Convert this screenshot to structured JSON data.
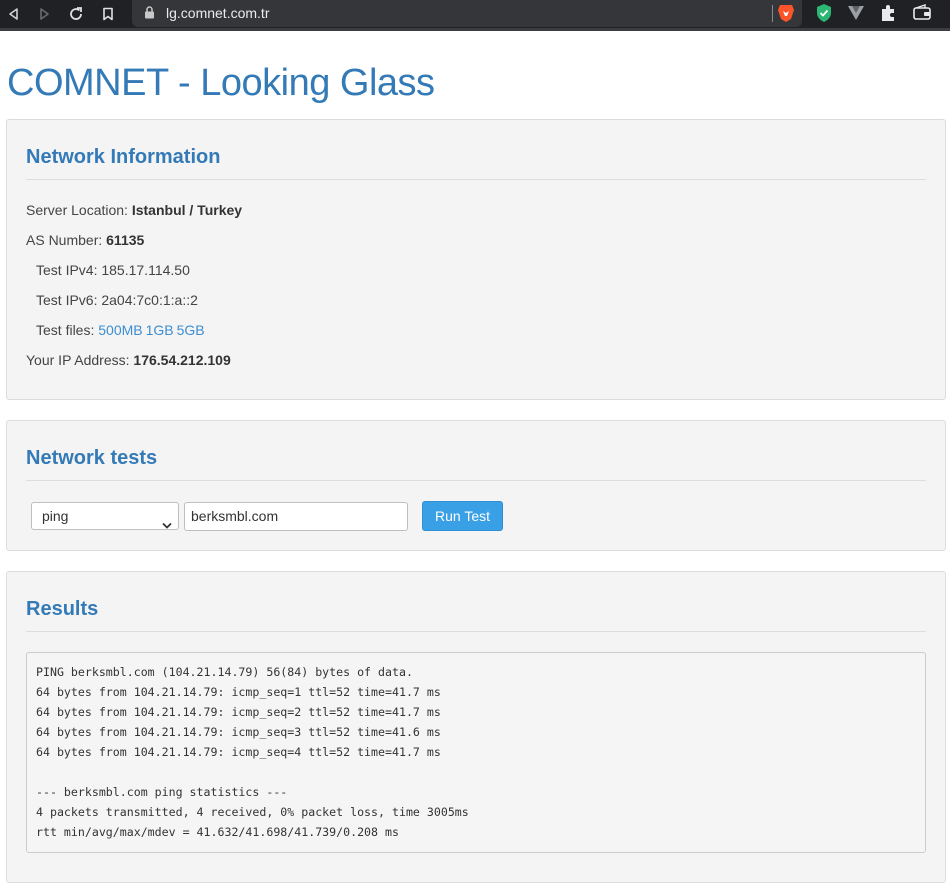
{
  "browser": {
    "url": "lg.comnet.com.tr",
    "icons": [
      "back-icon",
      "forward-icon",
      "reload-icon",
      "bookmark-icon",
      "lock-icon",
      "brave-shield-icon",
      "adblock-icon",
      "vpn-icon",
      "extensions-icon",
      "wallet-icon"
    ]
  },
  "page": {
    "title": "COMNET - Looking Glass"
  },
  "network_info": {
    "heading": "Network Information",
    "server_location_label": "Server Location:",
    "server_location_value": "Istanbul / Turkey",
    "as_number_label": "AS Number:",
    "as_number_value": "61135",
    "test_ipv4": "Test IPv4: 185.17.114.50",
    "test_ipv6": "Test IPv6: 2a04:7c0:1:a::2",
    "test_files_label": "Test files:",
    "test_files": [
      "500MB",
      "1GB",
      "5GB"
    ],
    "your_ip_label": "Your IP Address:",
    "your_ip_value": "176.54.212.109"
  },
  "network_tests": {
    "heading": "Network tests",
    "selected_method": "ping",
    "host_value": "berksmbl.com",
    "run_label": "Run Test"
  },
  "results": {
    "heading": "Results",
    "lines": [
      "PING berksmbl.com (104.21.14.79) 56(84) bytes of data.",
      "64 bytes from 104.21.14.79: icmp_seq=1 ttl=52 time=41.7 ms",
      "64 bytes from 104.21.14.79: icmp_seq=2 ttl=52 time=41.7 ms",
      "64 bytes from 104.21.14.79: icmp_seq=3 ttl=52 time=41.6 ms",
      "64 bytes from 104.21.14.79: icmp_seq=4 ttl=52 time=41.7 ms",
      "",
      "--- berksmbl.com ping statistics ---",
      "4 packets transmitted, 4 received, 0% packet loss, time 3005ms",
      "rtt min/avg/max/mdev = 41.632/41.698/41.739/0.208 ms"
    ]
  },
  "colors": {
    "accent": "#337ab7",
    "button": "#3aa0e6",
    "link": "#3d8ed0"
  }
}
